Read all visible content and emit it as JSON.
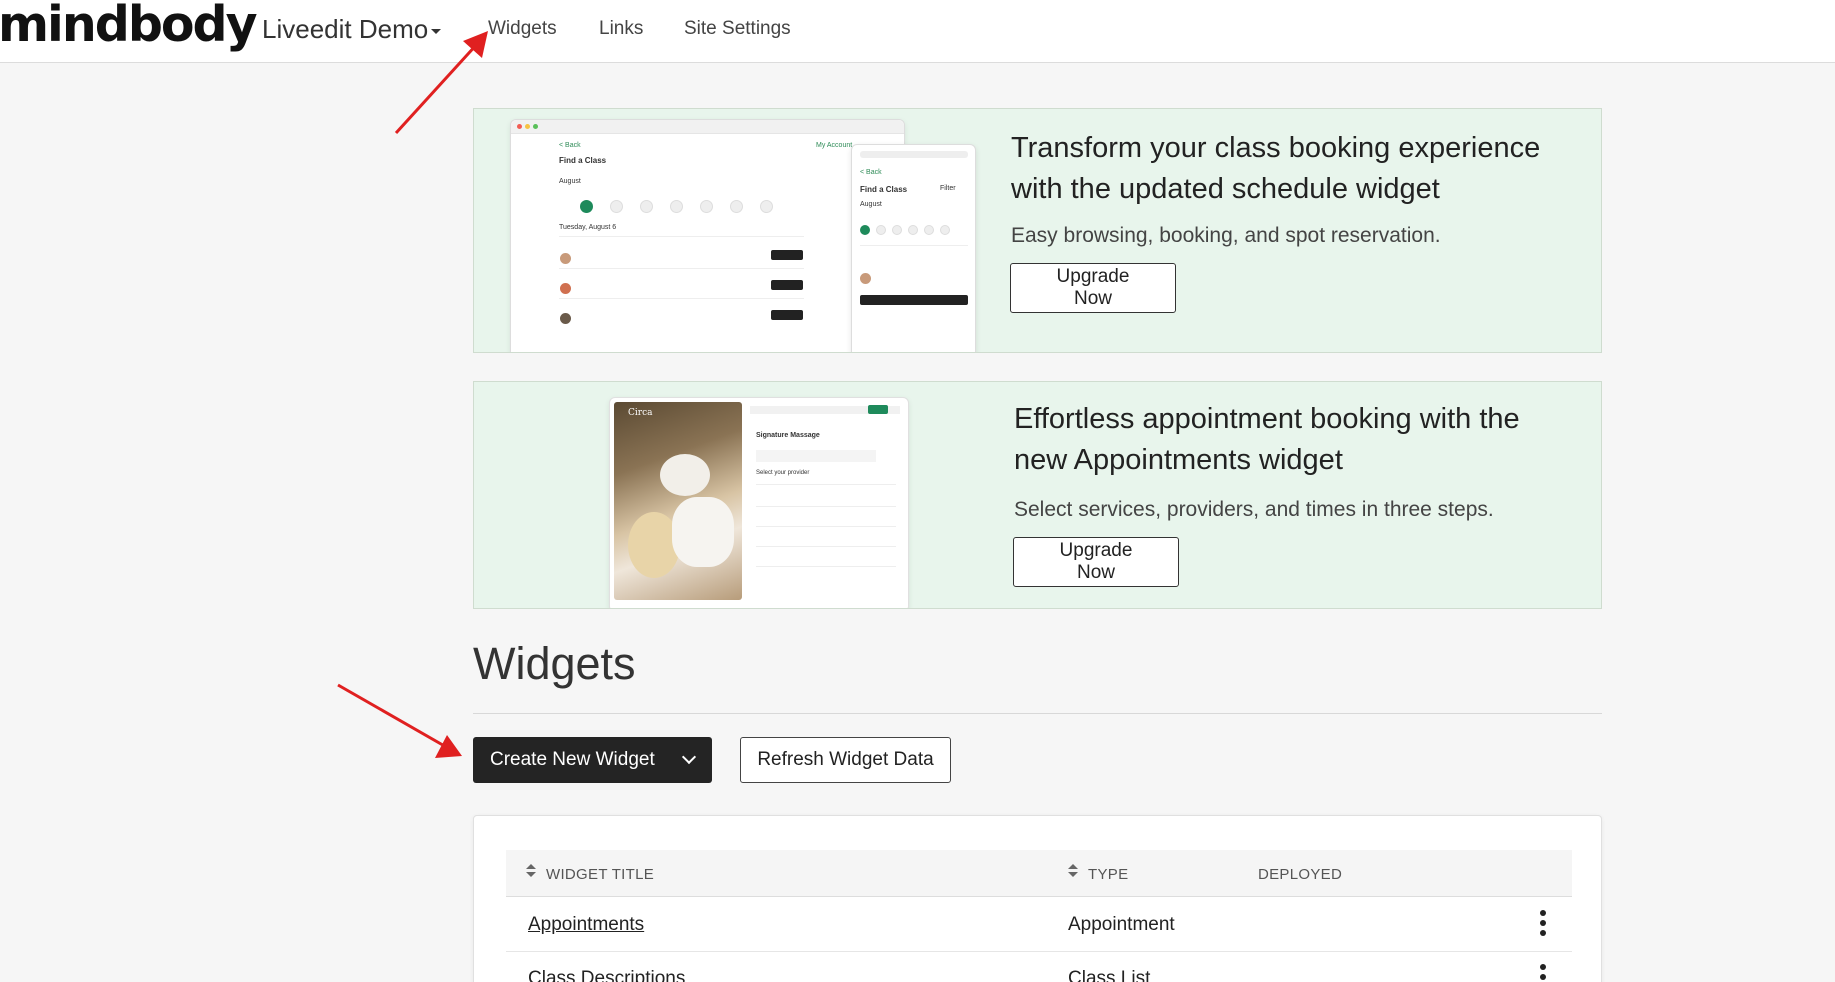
{
  "nav": {
    "logo": "mindbody",
    "site_name": "Liveedit Demo",
    "links": [
      "Widgets",
      "Links",
      "Site Settings"
    ]
  },
  "promo_schedule": {
    "title_line1": "Transform your class booking experience",
    "title_line2": "with the updated schedule widget",
    "subtitle": "Easy browsing, booking, and spot reservation.",
    "button": "Upgrade Now",
    "mock": {
      "back": "< Back",
      "account": "My Account",
      "heading": "Find a Class",
      "month": "August",
      "day_heading": "Tuesday, August 6",
      "filter": "Filter"
    }
  },
  "promo_appointments": {
    "title_line1": "Effortless appointment booking with the",
    "title_line2": "new Appointments widget",
    "subtitle": "Select services, providers, and times in three steps.",
    "button": "Upgrade Now",
    "mock": {
      "brand": "Circa",
      "service": "Signature Massage",
      "select_provider": "Select your provider"
    }
  },
  "widgets": {
    "heading": "Widgets",
    "create_button": "Create New Widget",
    "refresh_button": "Refresh Widget Data",
    "columns": [
      "WIDGET TITLE",
      "TYPE",
      "DEPLOYED"
    ],
    "rows": [
      {
        "title": "Appointments",
        "type": "Appointment"
      },
      {
        "title": "Class Descriptions",
        "type": "Class List"
      }
    ]
  },
  "colors": {
    "promo_bg": "#e8f5ec",
    "accent_green": "#1e8a5b",
    "dark_button": "#242424",
    "annotation_arrow": "#e02020"
  }
}
